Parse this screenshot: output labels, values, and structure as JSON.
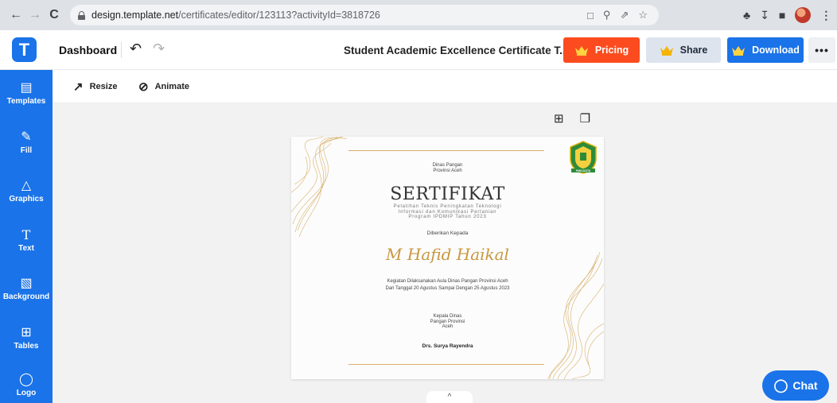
{
  "browser": {
    "url_host": "design.template.net",
    "url_path": "/certificates/editor/123113?activityId=3818726"
  },
  "header": {
    "logo_letter": "T",
    "dashboard_label": "Dashboard",
    "doc_title": "Student Academic Excellence Certificate T...",
    "pricing_label": "Pricing",
    "share_label": "Share",
    "download_label": "Download",
    "more_label": "•••"
  },
  "sidebar": {
    "items": [
      {
        "label": "Templates",
        "icon": "templates-icon"
      },
      {
        "label": "Fill",
        "icon": "pencil-icon"
      },
      {
        "label": "Graphics",
        "icon": "shapes-icon"
      },
      {
        "label": "Text",
        "icon": "text-icon"
      },
      {
        "label": "Background",
        "icon": "background-icon"
      },
      {
        "label": "Tables",
        "icon": "table-icon"
      },
      {
        "label": "Logo",
        "icon": "logo-icon"
      }
    ]
  },
  "toolbar": {
    "resize_label": "Resize",
    "animate_label": "Animate"
  },
  "certificate": {
    "org_line1": "Dinas Pangan",
    "org_line2": "Provinsi Aceh",
    "title": "SERTIFIKAT",
    "sub_line1": "Pelatihan Teknis Peningkatan Teknologi",
    "sub_line2": "Informasi dan Komunikasi Pertanian",
    "sub_line3": "Program IPDMIP Tahun 2023",
    "given_to": "Diberikan Kepada",
    "recipient": "M Hafid Haikal",
    "desc_line1": "Kegiatan Dilaksanakan Aula Dinas Pangan Provinsi Aceh",
    "desc_line2": "Dari Tanggal 20 Agustus Sampai Dengan 25 Agustus 2023",
    "head_line1": "Kepala Dinas",
    "head_line2": "Pangan Provinsi",
    "head_line3": "Aceh",
    "signer": "Drs. Surya Rayendra",
    "crest_text": "PANCACITA"
  },
  "chat": {
    "label": "Chat"
  },
  "colors": {
    "brand_blue": "#1a73e8",
    "pricing_orange": "#fc4c1f",
    "gold": "#c9973f"
  }
}
